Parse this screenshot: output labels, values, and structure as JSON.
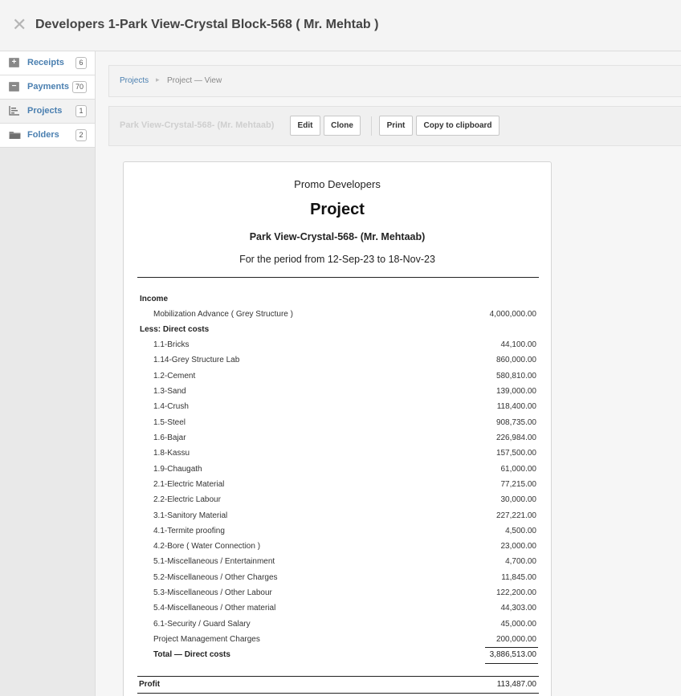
{
  "header": {
    "title": "Developers 1-Park View-Crystal Block-568 ( Mr. Mehtab )"
  },
  "sidebar": {
    "items": [
      {
        "label": "Receipts",
        "count": "6",
        "icon": "plus-box-icon"
      },
      {
        "label": "Payments",
        "count": "70",
        "icon": "minus-box-icon"
      },
      {
        "label": "Projects",
        "count": "1",
        "icon": "bar-chart-icon"
      },
      {
        "label": "Folders",
        "count": "2",
        "icon": "folder-icon"
      }
    ]
  },
  "breadcrumb": {
    "link": "Projects",
    "separator": "▸",
    "current": "Project — View"
  },
  "toolbar": {
    "title": "Park View-Crystal-568- (Mr. Mehtaab)",
    "edit": "Edit",
    "clone": "Clone",
    "print": "Print",
    "copy": "Copy to clipboard"
  },
  "report": {
    "company": "Promo Developers",
    "heading": "Project",
    "project": "Park View-Crystal-568- (Mr. Mehtaab)",
    "period": "For the period from 12-Sep-23 to 18-Nov-23",
    "income_label": "Income",
    "income_rows": [
      {
        "label": "Mobilization Advance ( Grey Structure )",
        "amount": "4,000,000.00"
      }
    ],
    "costs_label": "Less: Direct costs",
    "cost_rows": [
      {
        "label": "1.1-Bricks",
        "amount": "44,100.00"
      },
      {
        "label": "1.14-Grey Structure Lab",
        "amount": "860,000.00"
      },
      {
        "label": "1.2-Cement",
        "amount": "580,810.00"
      },
      {
        "label": "1.3-Sand",
        "amount": "139,000.00"
      },
      {
        "label": "1.4-Crush",
        "amount": "118,400.00"
      },
      {
        "label": "1.5-Steel",
        "amount": "908,735.00"
      },
      {
        "label": "1.6-Bajar",
        "amount": "226,984.00"
      },
      {
        "label": "1.8-Kassu",
        "amount": "157,500.00"
      },
      {
        "label": "1.9-Chaugath",
        "amount": "61,000.00"
      },
      {
        "label": "2.1-Electric Material",
        "amount": "77,215.00"
      },
      {
        "label": "2.2-Electric Labour",
        "amount": "30,000.00"
      },
      {
        "label": "3.1-Sanitory Material",
        "amount": "227,221.00"
      },
      {
        "label": "4.1-Termite proofing",
        "amount": "4,500.00"
      },
      {
        "label": "4.2-Bore ( Water Connection )",
        "amount": "23,000.00"
      },
      {
        "label": "5.1-Miscellaneous / Entertainment",
        "amount": "4,700.00"
      },
      {
        "label": "5.2-Miscellaneous / Other Charges",
        "amount": "11,845.00"
      },
      {
        "label": "5.3-Miscellaneous / Other Labour",
        "amount": "122,200.00"
      },
      {
        "label": "5.4-Miscellaneous / Other material",
        "amount": "44,303.00"
      },
      {
        "label": "6.1-Security / Guard Salary",
        "amount": "45,000.00"
      },
      {
        "label": "Project Management Charges",
        "amount": "200,000.00"
      }
    ],
    "total_label": "Total — Direct costs",
    "total_amount": "3,886,513.00",
    "profit_label": "Profit",
    "profit_amount": "113,487.00"
  }
}
